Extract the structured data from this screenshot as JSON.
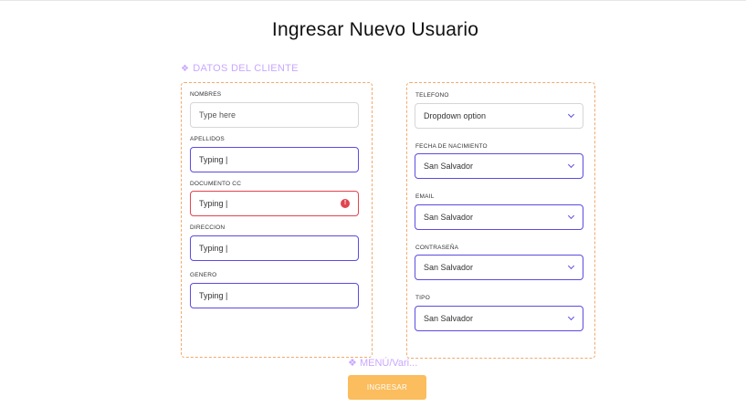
{
  "page": {
    "title": "Ingresar Nuevo Usuario"
  },
  "section": {
    "label": "DATOS DEL CLIENTE",
    "icon": "diamond-cluster-icon"
  },
  "left_fields": [
    {
      "label": "NOMBRES",
      "value": "Type here",
      "state": "empty"
    },
    {
      "label": "APELLIDOS",
      "value": "Typing |",
      "state": "active"
    },
    {
      "label": "DOCUMENTO CC",
      "value": "Typing |",
      "state": "error"
    },
    {
      "label": "DIRECCION",
      "value": "Typing |",
      "state": "active"
    },
    {
      "label": "GENERO",
      "value": "Typing |",
      "state": "active"
    }
  ],
  "right_fields": [
    {
      "label": "TELEFONO",
      "value": "Dropdown option",
      "state": "default"
    },
    {
      "label": "FECHA DE NACIMIENTO",
      "value": "San Salvador",
      "state": "active"
    },
    {
      "label": "EMAIL",
      "value": "San Salvador",
      "state": "active"
    },
    {
      "label": "CONTRASEÑA",
      "value": "San Salvador",
      "state": "active"
    },
    {
      "label": "TIPO",
      "value": "San Salvador",
      "state": "active"
    }
  ],
  "menu": {
    "label": "MENÚ/Vari..."
  },
  "submit": {
    "label": "INGRESAR"
  },
  "colors": {
    "accent": "#5b4ce0",
    "error": "#e0454f",
    "dashed_border": "#f3a96b",
    "label_purple": "#c9a7ff",
    "button": "#fbbd5d"
  }
}
